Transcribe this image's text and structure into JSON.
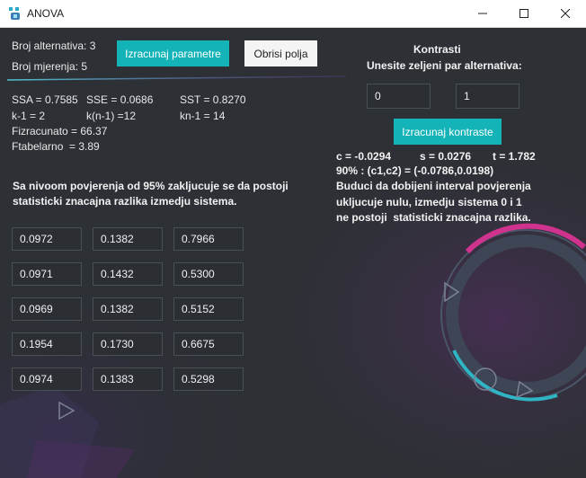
{
  "window": {
    "title": "ANOVA"
  },
  "params": {
    "alt_label": "Broj alternativa: 3",
    "mjer_label": "Broj mjerenja: 5",
    "calc_button": "Izracunaj parametre",
    "clear_button": "Obrisi polja"
  },
  "stats": {
    "ssa": "SSA = 0.7585",
    "sse": "SSE = 0.0686",
    "sst": "SST = 0.8270",
    "k1": "k-1 = 2",
    "kn1": "k(n-1) =12",
    "knm1": "kn-1 = 14",
    "fizracunato": "Fizracunato = 66.37",
    "ftabelarno": "Ftabelarno  = 3.89"
  },
  "conclusion": {
    "line1": "Sa nivoom povjerenja od 95% zakljucuje se da postoji",
    "line2": "statisticki znacajna razlika izmedju sistema."
  },
  "table": [
    [
      "0.0972",
      "0.1382",
      "0.7966"
    ],
    [
      "0.0971",
      "0.1432",
      "0.5300"
    ],
    [
      "0.0969",
      "0.1382",
      "0.5152"
    ],
    [
      "0.1954",
      "0.1730",
      "0.6675"
    ],
    [
      "0.0974",
      "0.1383",
      "0.5298"
    ]
  ],
  "contrasts": {
    "heading": "Kontrasti",
    "subheading": "Unesite zeljeni par alternativa:",
    "first_value": "0",
    "second_value": "1",
    "calc_button": "Izracunaj kontraste",
    "c": "c = -0.0294",
    "s": "s = 0.0276",
    "t": "t = 1.782",
    "interval": "90% : (c1,c2) = (-0.0786,0.0198)",
    "note1": "Buduci da dobijeni interval povjerenja",
    "note2": "ukljucuje nulu, izmedju sistema 0 i 1",
    "note3": "ne postoji  statisticki znacajna razlika."
  }
}
